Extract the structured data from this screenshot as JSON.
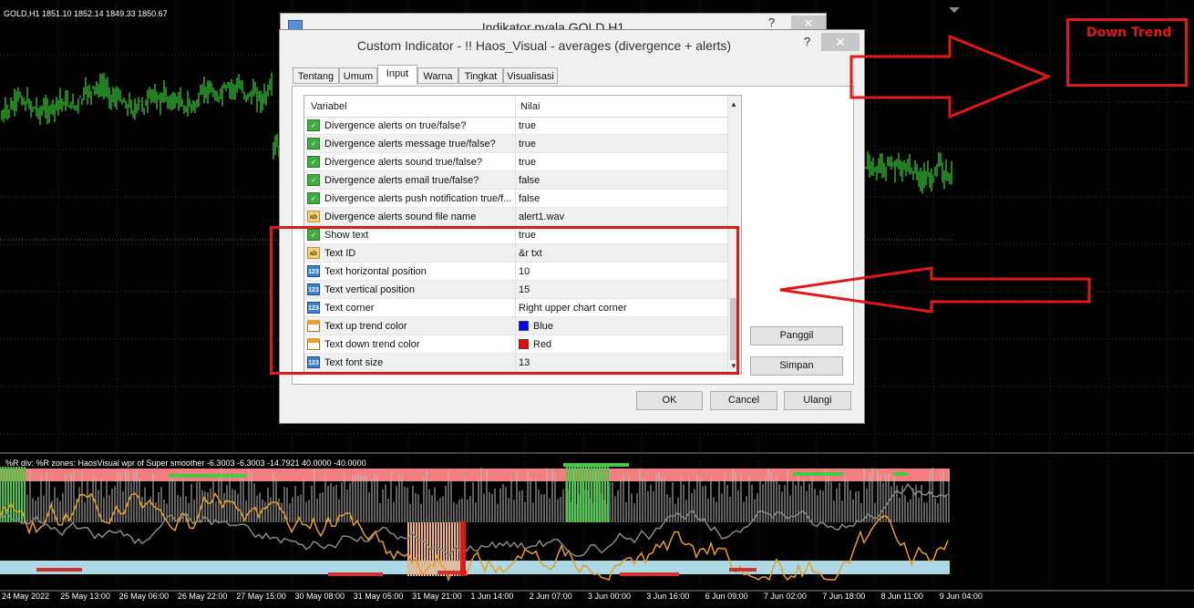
{
  "chart": {
    "symbol_header": "GOLD,H1  1851.10 1852.14 1849.33 1850.67",
    "indicator_header": "%R div: %R zones:  HaosVisual wpr of Super smoother -6.3003 -6.3003 -14.7921 40.0000 -40.0000",
    "x_labels": [
      "24 May 2022",
      "25 May 13:00",
      "26 May 06:00",
      "26 May 22:00",
      "27 May 15:00",
      "30 May 08:00",
      "31 May 05:00",
      "31 May 21:00",
      "1 Jun 14:00",
      "2 Jun 07:00",
      "3 Jun 00:00",
      "3 Jun 16:00",
      "6 Jun 09:00",
      "7 Jun 02:00",
      "7 Jun 18:00",
      "8 Jun 11:00",
      "9 Jun 04:00"
    ],
    "annotation": "Down Trend",
    "colors": {
      "candles": "#44ff44",
      "overbought_band": "#f08080",
      "oversold_band": "#add8e6",
      "wpr_line": "#e8a020",
      "up_trend": "#44cc44",
      "down_trend": "#e01818"
    }
  },
  "back_dialog": {
    "title": "Indikator nvala GOLD.H1",
    "help": "?",
    "close": "✕"
  },
  "dialog": {
    "title": "Custom Indicator - !! Haos_Visual - averages (divergence + alerts)",
    "help": "?",
    "close": "✕",
    "tabs": [
      "Tentang",
      "Umum",
      "Input",
      "Warna",
      "Tingkat",
      "Visualisasi"
    ],
    "active_tab": "Input",
    "columns": {
      "variable": "Variabel",
      "value": "Nilai"
    },
    "rows": [
      {
        "icon": "bool",
        "name": "Divergence alerts on true/false?",
        "value": "true"
      },
      {
        "icon": "bool",
        "name": "Divergence alerts message true/false?",
        "value": "true"
      },
      {
        "icon": "bool",
        "name": "Divergence alerts sound true/false?",
        "value": "true"
      },
      {
        "icon": "bool",
        "name": "Divergence alerts email true/false?",
        "value": "false"
      },
      {
        "icon": "bool",
        "name": "Divergence alerts push notification true/f...",
        "value": "false"
      },
      {
        "icon": "str",
        "name": "Divergence alerts sound file name",
        "value": "alert1.wav"
      },
      {
        "icon": "bool",
        "name": "Show text",
        "value": "true"
      },
      {
        "icon": "str",
        "name": "Text ID",
        "value": "&r txt"
      },
      {
        "icon": "num",
        "name": "Text horizontal position",
        "value": "10"
      },
      {
        "icon": "num",
        "name": "Text vertical position",
        "value": "15"
      },
      {
        "icon": "num",
        "name": "Text corner",
        "value": "Right upper chart corner"
      },
      {
        "icon": "col",
        "name": "Text up trend color",
        "value": "Blue",
        "swatch": "#0000ff"
      },
      {
        "icon": "col",
        "name": "Text down trend color",
        "value": "Red",
        "swatch": "#ff0000"
      },
      {
        "icon": "num",
        "name": "Text font size",
        "value": "13"
      }
    ],
    "buttons": {
      "load": "Panggil",
      "save": "Simpan",
      "ok": "OK",
      "cancel": "Cancel",
      "reset": "Ulangi"
    }
  }
}
